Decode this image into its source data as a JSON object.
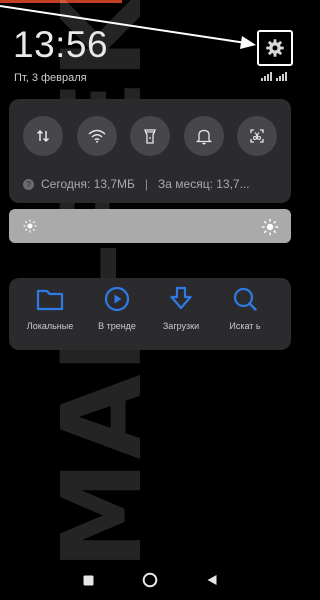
{
  "status_bar": {
    "time": "13:56",
    "date": "Пт, 3 февраля"
  },
  "settings": {
    "icon": "gear-icon",
    "highlight_color": "#ffffff"
  },
  "quick_toggles": [
    {
      "name": "mobile-data",
      "icon": "data-transfer-icon",
      "active": false
    },
    {
      "name": "wifi",
      "icon": "wifi-icon",
      "active": false
    },
    {
      "name": "flashlight",
      "icon": "flashlight-icon",
      "active": false
    },
    {
      "name": "sound",
      "icon": "bell-icon",
      "active": false
    },
    {
      "name": "screenshot",
      "icon": "screenshot-icon",
      "active": false
    }
  ],
  "traffic": {
    "today": "Сегодня: 13,7МБ",
    "separator": "|",
    "month": "За месяц: 13,7..."
  },
  "brightness": {
    "level": 0
  },
  "shortcuts": [
    {
      "label": "Локальные",
      "icon": "folder-icon"
    },
    {
      "label": "В тренде",
      "icon": "play-icon"
    },
    {
      "label": "Загрузки",
      "icon": "download-icon"
    },
    {
      "label": "Искат ь",
      "icon": "search-icon"
    }
  ],
  "watermark": {
    "text": "MAR-REKA.RU"
  },
  "colors": {
    "accent_blue": "#2f7be6",
    "panel": "#2b2b2e",
    "toggle": "#47474b",
    "slider": "#aaaaaa",
    "top_accent": "#c2401f"
  }
}
